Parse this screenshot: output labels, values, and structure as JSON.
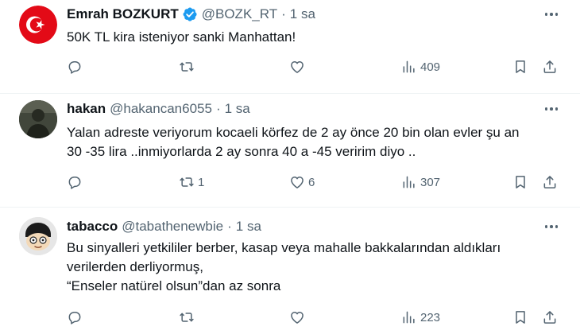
{
  "tweets": [
    {
      "name": "Emrah BOZKURT",
      "handle": "@BOZK_RT",
      "dot": "·",
      "time": "1 sa",
      "verified": true,
      "lines": [
        "50K TL kira isteniyor sanki Manhattan!"
      ],
      "replies": "",
      "retweets": "",
      "likes": "",
      "views": "409"
    },
    {
      "name": "hakan",
      "handle": "@hakancan6055",
      "dot": "·",
      "time": "1 sa",
      "verified": false,
      "lines": [
        "Yalan adreste veriyorum kocaeli körfez de 2 ay önce 20 bin olan evler şu an",
        "30  -35 lira ..inmiyorlarda 2 ay sonra 40 a -45 veririm diyo .."
      ],
      "replies": "",
      "retweets": "1",
      "likes": "6",
      "views": "307"
    },
    {
      "name": "tabacco",
      "handle": "@tabathenewbie",
      "dot": "·",
      "time": "1 sa",
      "verified": false,
      "lines": [
        "Bu sinyalleri yetkililer berber, kasap veya mahalle bakkalarından aldıkları",
        "verilerden derliyormuş,",
        "“Enseler natürel olsun”dan az sonra"
      ],
      "replies": "",
      "retweets": "",
      "likes": "",
      "views": "223"
    }
  ],
  "icons": {
    "reply": "reply-icon",
    "retweet": "retweet-icon",
    "like": "heart-icon",
    "views": "views-icon",
    "bookmark": "bookmark-icon",
    "share": "share-icon",
    "more": "more-icon",
    "verified": "verified-badge-icon"
  },
  "colors": {
    "verified": "#1d9bf0",
    "flag_red": "#e30a17",
    "secondary_text": "#536471"
  }
}
